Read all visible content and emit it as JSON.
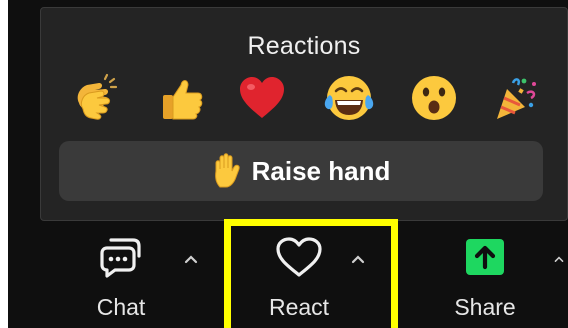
{
  "popup": {
    "title": "Reactions",
    "emojis": [
      {
        "icon": "clapping-hands-icon"
      },
      {
        "icon": "thumbs-up-icon"
      },
      {
        "icon": "red-heart-icon"
      },
      {
        "icon": "tears-of-joy-icon"
      },
      {
        "icon": "surprised-face-icon"
      },
      {
        "icon": "party-popper-icon"
      }
    ],
    "raise_hand": {
      "icon": "raised-hand-icon",
      "label": "Raise hand"
    }
  },
  "toolbar": {
    "chat": {
      "label": "Chat",
      "icon": "chat-bubbles-icon"
    },
    "react": {
      "label": "React",
      "icon": "heart-outline-icon"
    },
    "share": {
      "label": "Share",
      "icon": "share-screen-icon"
    }
  },
  "colors": {
    "background": "#0f0f0f",
    "popup": "#242424",
    "raise_hand_button": "#3a3a3a",
    "share_green": "#1ed760",
    "highlight": "#ffff00"
  }
}
